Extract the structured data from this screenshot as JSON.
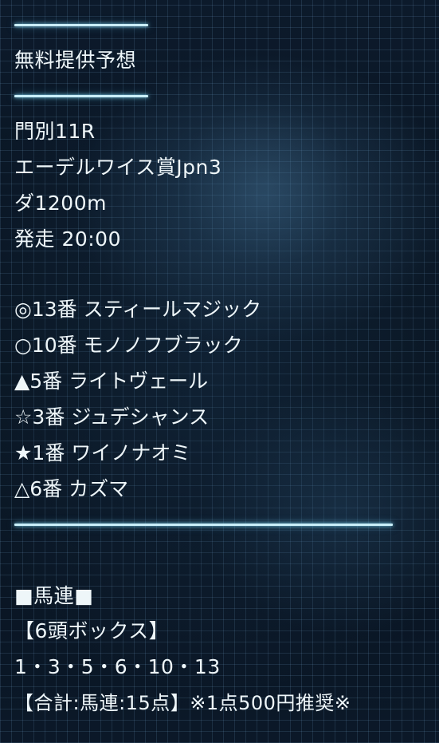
{
  "section_title": "無料提供予想",
  "race": {
    "venue_race": "門別11R",
    "race_name": "エーデルワイス賞Jpn3",
    "course": "ダ1200m",
    "post_time": "発走 20:00"
  },
  "picks": [
    {
      "mark": "◎",
      "number": "13番",
      "horse": "スティールマジック"
    },
    {
      "mark": "○",
      "number": "10番",
      "horse": "モノノフブラック"
    },
    {
      "mark": "▲",
      "number": "5番",
      "horse": "ライトヴェール"
    },
    {
      "mark": "☆",
      "number": "3番",
      "horse": "ジュデシャンス"
    },
    {
      "mark": "★",
      "number": "1番",
      "horse": "ワイノナオミ"
    },
    {
      "mark": "△",
      "number": "6番",
      "horse": "カズマ"
    }
  ],
  "bet": {
    "type_label": "■馬連■",
    "format": "【6頭ボックス】",
    "numbers": "1・3・5・6・10・13",
    "summary": "【合計:馬連:15点】※1点500円推奨※"
  },
  "colors": {
    "background": "#0a1626",
    "grid": "#78aad2",
    "text": "#eef6f9",
    "rule": "#c9eef8"
  }
}
